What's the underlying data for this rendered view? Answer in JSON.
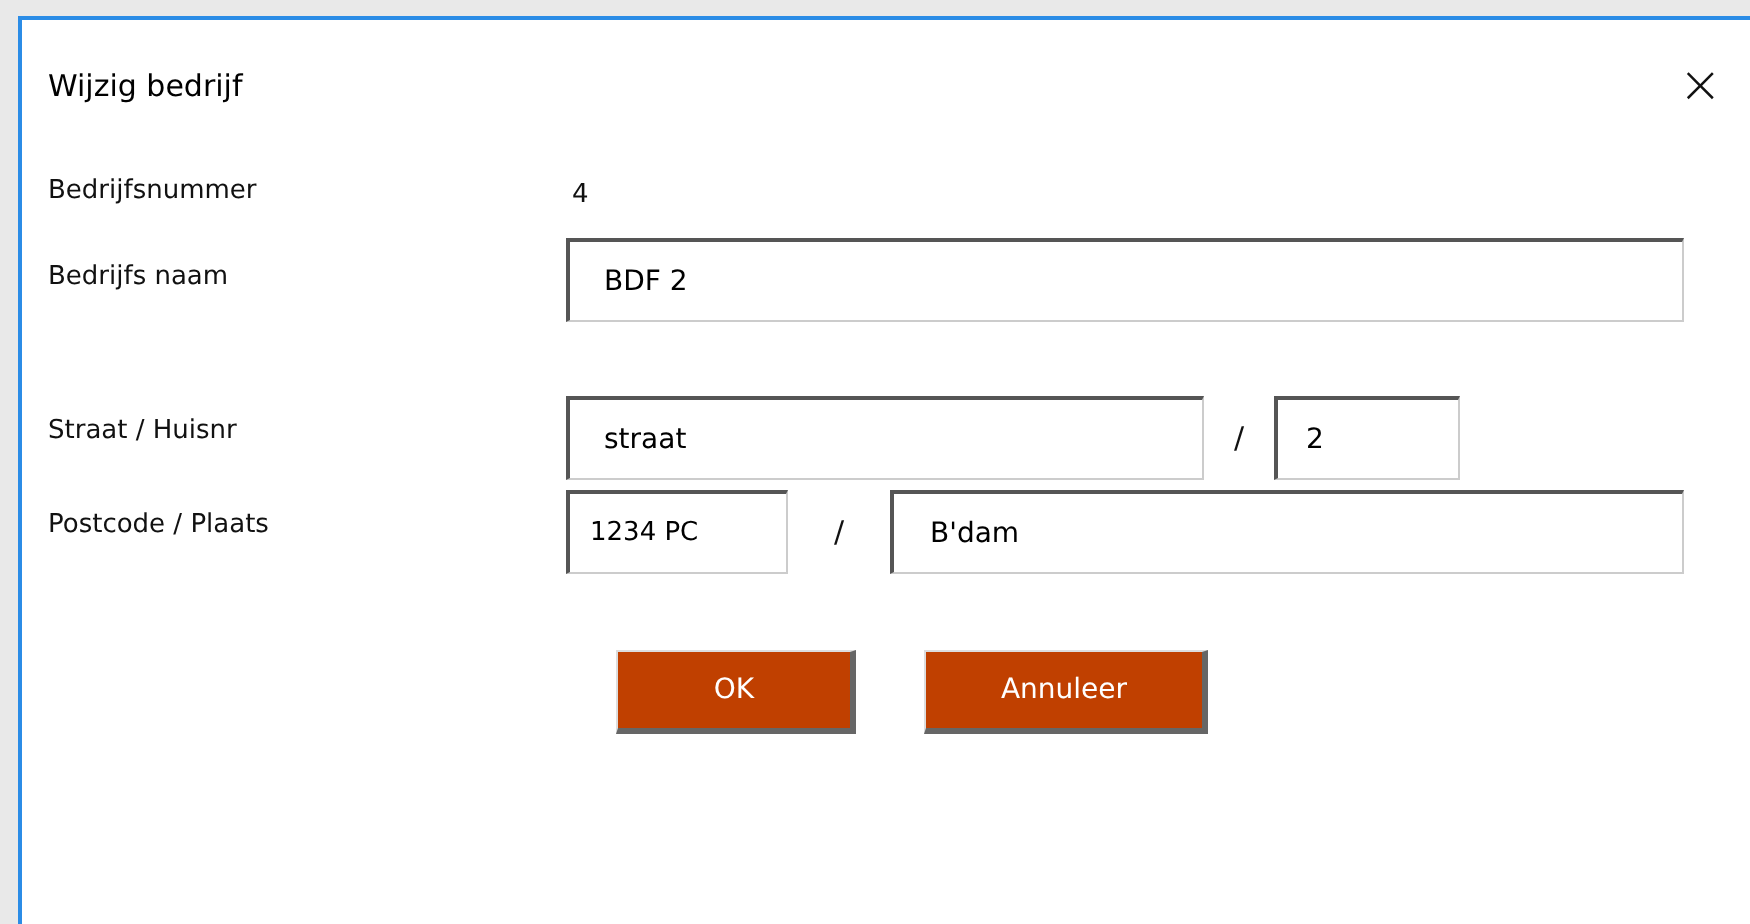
{
  "window": {
    "title": "Wijzig bedrijf",
    "close": "×"
  },
  "fields": [
    {
      "label": "Bedrijfsnummer",
      "kind": "text",
      "value": "4"
    },
    {
      "label": "Bedrijfs naam",
      "kind": "input",
      "value": "BDF 2"
    }
  ],
  "address": [
    {
      "label": "Straat / Huisnr",
      "first": "straat",
      "separator": "/",
      "second": "2",
      "kind": "street"
    },
    {
      "label": "Postcode / Plaats",
      "first": "1234 PC",
      "separator": "/",
      "second": "B'dam",
      "kind": "city"
    }
  ],
  "buttons": [
    "OK",
    "Annuleer"
  ]
}
